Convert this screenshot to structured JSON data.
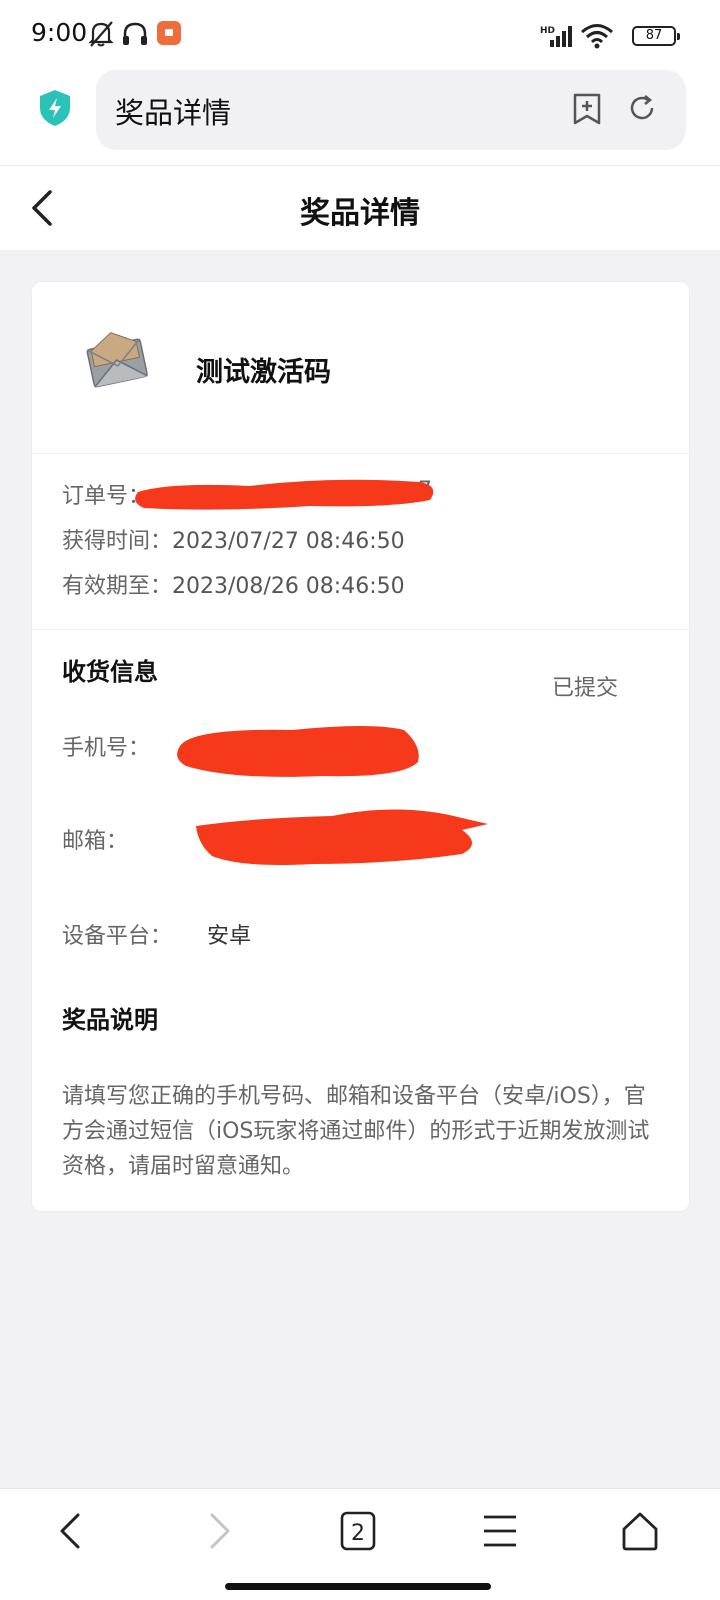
{
  "status_bar": {
    "time": "9:00",
    "network": "HD",
    "battery": "87",
    "icons": [
      "bell-off-icon",
      "headphones-icon",
      "app-notification-icon",
      "signal-icon",
      "wifi-icon",
      "battery-icon"
    ]
  },
  "browser": {
    "url_title": "奖品详情",
    "icons": [
      "shield-bolt-icon",
      "bookmark-add-icon",
      "reload-icon"
    ]
  },
  "header": {
    "title": "奖品详情",
    "icons": [
      "back-chevron-icon"
    ]
  },
  "prize": {
    "name": "测试激活码",
    "image": "envelope-image"
  },
  "order": {
    "order_no_label": "订单号：",
    "order_no_partial": "7",
    "obtained_label": "获得时间：",
    "obtained_value": "2023/07/27 08:46:50",
    "expiry_label": "有效期至：",
    "expiry_value": "2023/08/26 08:46:50"
  },
  "shipping": {
    "title": "收货信息",
    "status": "已提交",
    "phone_label": "手机号：",
    "email_label": "邮箱：",
    "platform_label": "设备平台：",
    "platform_value": "安卓"
  },
  "description": {
    "title": "奖品说明",
    "text": "请填写您正确的手机号码、邮箱和设备平台（安卓/iOS），官方会通过短信（iOS玩家将通过邮件）的形式于近期发放测试资格，请届时留意通知。"
  },
  "bottom_nav": {
    "tab_count": "2",
    "icons": [
      "back-icon",
      "forward-icon",
      "tabs-icon",
      "menu-icon",
      "home-icon"
    ]
  },
  "colors": {
    "redaction": "#f5391a",
    "shield": "#2bc3b8",
    "notify": "#f26b3a",
    "page_bg": "#f2f2f4"
  }
}
